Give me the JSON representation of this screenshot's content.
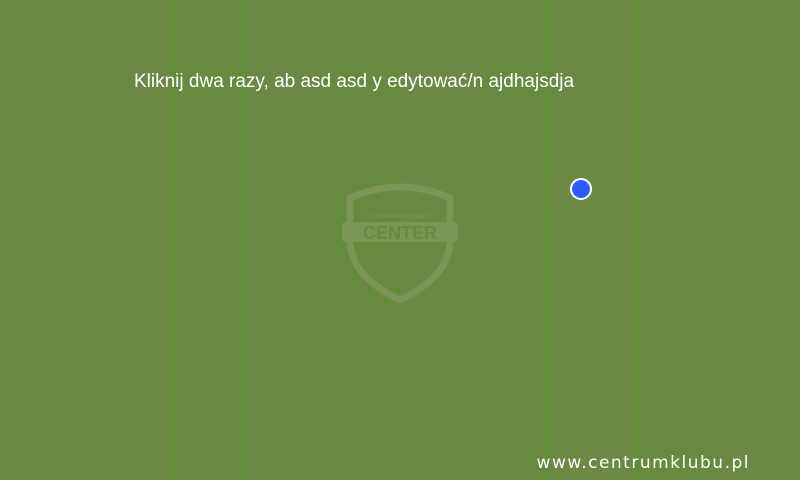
{
  "pitch": {
    "stripe_colors": [
      "#668a3e",
      "#6b8844"
    ]
  },
  "editable_text": {
    "label": "Kliknij dwa razy, ab asd asd y edytować/n ajdhajsdja"
  },
  "watermark": {
    "logo_small_text": "CLUB MANAGEMENT",
    "logo_main_text": "CENTER"
  },
  "marker": {
    "color": "#2f5cff"
  },
  "footer": {
    "url": "www.centrumklubu.pl"
  }
}
